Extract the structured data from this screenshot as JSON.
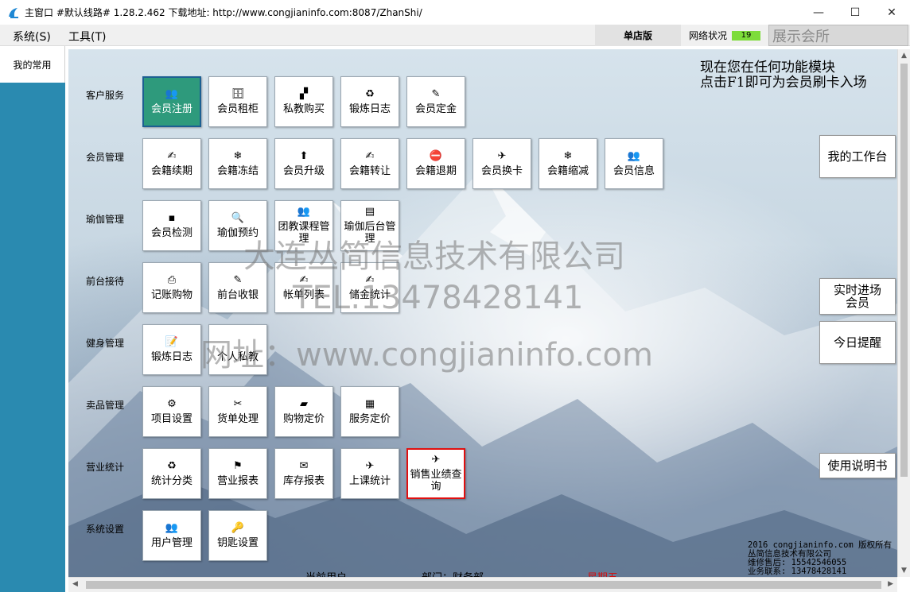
{
  "window": {
    "title": "主窗口 #默认线路# 1.28.2.462 下载地址: http://www.congjianinfo.com:8087/ZhanShi/",
    "minimize": "—",
    "maximize": "☐",
    "close": "✕"
  },
  "menu": {
    "system": "系统(S)",
    "tools": "工具(T)",
    "shop_mode": "单店版",
    "network_label": "网络状况",
    "network_value": "19",
    "display_venue": "展示会所"
  },
  "sidebar": {
    "tab_label": "我的常用"
  },
  "categories": [
    {
      "label": "客户服务"
    },
    {
      "label": "会员管理"
    },
    {
      "label": "瑜伽管理"
    },
    {
      "label": "前台接待"
    },
    {
      "label": "健身管理"
    },
    {
      "label": "卖品管理"
    },
    {
      "label": "营业统计"
    },
    {
      "label": "系统设置"
    }
  ],
  "tiles": {
    "customer_service": [
      {
        "label": "会员注册",
        "icon": "👥"
      },
      {
        "label": "会员租柜",
        "icon": "🗄"
      },
      {
        "label": "私教购买",
        "icon": "▞"
      },
      {
        "label": "锻炼日志",
        "icon": "♻"
      },
      {
        "label": "会员定金",
        "icon": "✎"
      }
    ],
    "member_mgmt": [
      {
        "label": "会籍续期",
        "icon": "✍"
      },
      {
        "label": "会籍冻结",
        "icon": "❄"
      },
      {
        "label": "会员升级",
        "icon": "⬆"
      },
      {
        "label": "会籍转让",
        "icon": "✍"
      },
      {
        "label": "会籍退期",
        "icon": "⛔"
      },
      {
        "label": "会员换卡",
        "icon": "✈"
      },
      {
        "label": "会籍缩减",
        "icon": "❄"
      },
      {
        "label": "会员信息",
        "icon": "👥"
      }
    ],
    "yoga_mgmt": [
      {
        "label": "会员检测",
        "icon": "▪"
      },
      {
        "label": "瑜伽预约",
        "icon": "🔍"
      },
      {
        "label": "团教课程管理",
        "icon": "👥"
      },
      {
        "label": "瑜伽后台管理",
        "icon": "▤"
      }
    ],
    "front_desk": [
      {
        "label": "记账购物",
        "icon": "⎙"
      },
      {
        "label": "前台收银",
        "icon": "✎"
      },
      {
        "label": "帐单列表",
        "icon": "✍"
      },
      {
        "label": "储金统计",
        "icon": "✍"
      }
    ],
    "fitness_mgmt": [
      {
        "label": "锻炼日志",
        "icon": "📝"
      },
      {
        "label": "个人私教",
        "icon": ""
      }
    ],
    "retail_mgmt": [
      {
        "label": "项目设置",
        "icon": "⚙"
      },
      {
        "label": "货单处理",
        "icon": "✂"
      },
      {
        "label": "购物定价",
        "icon": "▰"
      },
      {
        "label": "服务定价",
        "icon": "▦"
      }
    ],
    "business_stats": [
      {
        "label": "统计分类",
        "icon": "♻"
      },
      {
        "label": "营业报表",
        "icon": "⚑"
      },
      {
        "label": "库存报表",
        "icon": "✉"
      },
      {
        "label": "上课统计",
        "icon": "✈"
      },
      {
        "label": "销售业绩查询",
        "icon": "✈"
      }
    ],
    "system_settings": [
      {
        "label": "用户管理",
        "icon": "👥"
      },
      {
        "label": "钥匙设置",
        "icon": "🔑"
      }
    ]
  },
  "notice": {
    "line1": "现在您在任何功能模块",
    "line2": "点击F1即可为会员刷卡入场"
  },
  "side_buttons": {
    "workbench": "我的工作台",
    "realtime_members": "实时进场会员",
    "today_reminder": "今日提醒",
    "manual": "使用说明书"
  },
  "watermark": {
    "company": "大连丛简信息技术有限公司",
    "phone": "TEL:13478428141",
    "website": "网址：www.congjianinfo.com"
  },
  "copyright": {
    "line1": "2016 congjianinfo.com 版权所有",
    "line2": "丛简信息技术有限公司",
    "line3": "维修售后: 15542546055",
    "line4": "业务联系: 13478428141"
  },
  "footer": {
    "current_user": "当前用户",
    "department": "部门：财务部",
    "weekday": "星期五"
  }
}
